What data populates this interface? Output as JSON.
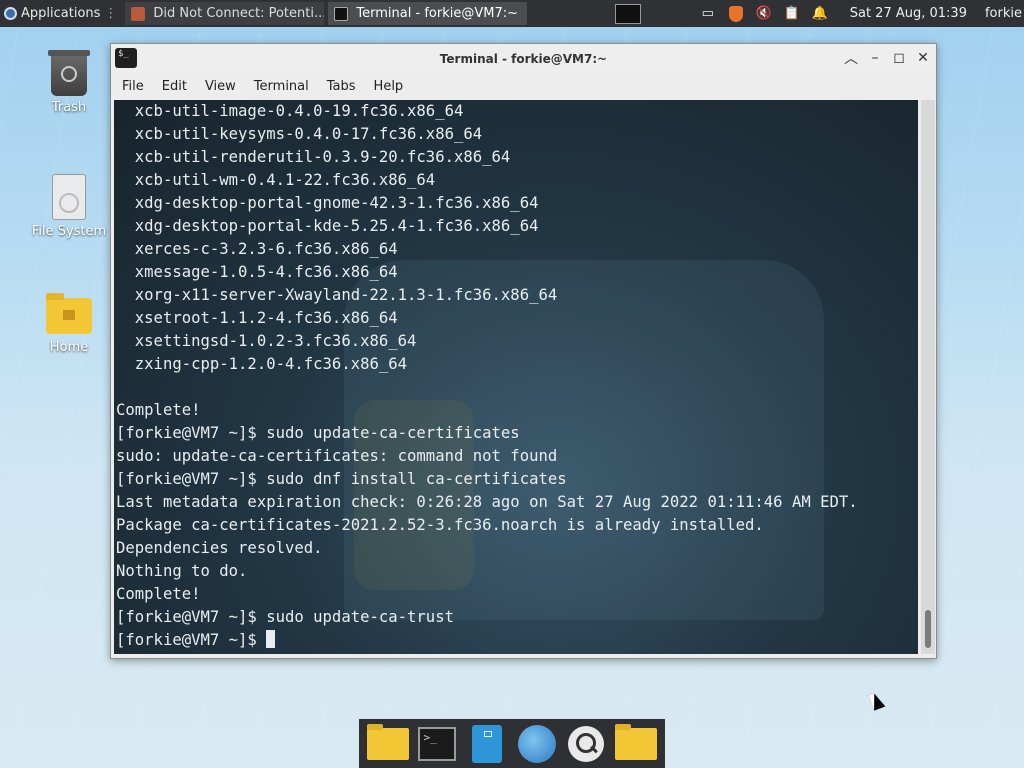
{
  "top_panel": {
    "applications_label": "Applications",
    "tasks": [
      {
        "label": "Did Not Connect: Potenti..."
      },
      {
        "label": "Terminal - forkie@VM7:~"
      }
    ],
    "clock": "Sat 27 Aug, 01:39",
    "user": "forkie"
  },
  "desktop_icons": {
    "trash": "Trash",
    "filesystem": "File System",
    "home": "Home"
  },
  "terminal": {
    "window_title": "Terminal - forkie@VM7:~",
    "menu": [
      "File",
      "Edit",
      "View",
      "Terminal",
      "Tabs",
      "Help"
    ],
    "lines": [
      "  xcb-util-image-0.4.0-19.fc36.x86_64",
      "  xcb-util-keysyms-0.4.0-17.fc36.x86_64",
      "  xcb-util-renderutil-0.3.9-20.fc36.x86_64",
      "  xcb-util-wm-0.4.1-22.fc36.x86_64",
      "  xdg-desktop-portal-gnome-42.3-1.fc36.x86_64",
      "  xdg-desktop-portal-kde-5.25.4-1.fc36.x86_64",
      "  xerces-c-3.2.3-6.fc36.x86_64",
      "  xmessage-1.0.5-4.fc36.x86_64",
      "  xorg-x11-server-Xwayland-22.1.3-1.fc36.x86_64",
      "  xsetroot-1.1.2-4.fc36.x86_64",
      "  xsettingsd-1.0.2-3.fc36.x86_64",
      "  zxing-cpp-1.2.0-4.fc36.x86_64",
      "",
      "Complete!",
      "[forkie@VM7 ~]$ sudo update-ca-certificates",
      "sudo: update-ca-certificates: command not found",
      "[forkie@VM7 ~]$ sudo dnf install ca-certificates",
      "Last metadata expiration check: 0:26:28 ago on Sat 27 Aug 2022 01:11:46 AM EDT.",
      "Package ca-certificates-2021.2.52-3.fc36.noarch is already installed.",
      "Dependencies resolved.",
      "Nothing to do.",
      "Complete!",
      "[forkie@VM7 ~]$ sudo update-ca-trust"
    ],
    "prompt": "[forkie@VM7 ~]$ "
  }
}
